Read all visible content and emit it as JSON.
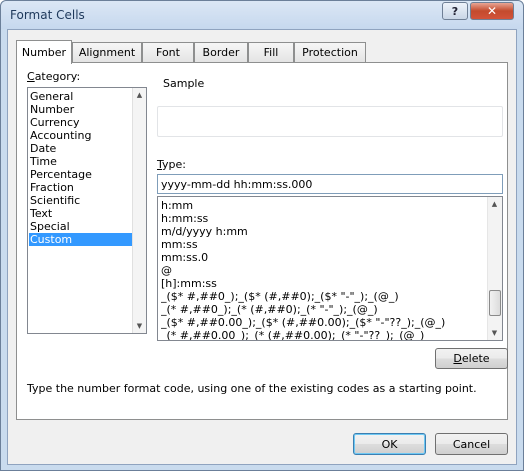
{
  "window": {
    "title": "Format Cells",
    "help_label": "?",
    "close_label": "✕"
  },
  "tabs": [
    {
      "label": "Number",
      "active": true
    },
    {
      "label": "Alignment",
      "active": false
    },
    {
      "label": "Font",
      "active": false
    },
    {
      "label": "Border",
      "active": false
    },
    {
      "label": "Fill",
      "active": false
    },
    {
      "label": "Protection",
      "active": false
    }
  ],
  "category": {
    "label_first": "C",
    "label_rest": "ategory:",
    "items": [
      "General",
      "Number",
      "Currency",
      "Accounting",
      "Date",
      "Time",
      "Percentage",
      "Fraction",
      "Scientific",
      "Text",
      "Special",
      "Custom"
    ],
    "selected": "Custom"
  },
  "sample": {
    "label": "Sample",
    "value": ""
  },
  "type": {
    "label_first": "T",
    "label_rest": "ype:",
    "value": "yyyy-mm-dd hh:mm:ss.000",
    "formats": [
      "h:mm",
      "h:mm:ss",
      "m/d/yyyy h:mm",
      "mm:ss",
      "mm:ss.0",
      "@",
      "[h]:mm:ss",
      "_($* #,##0_);_($* (#,##0);_($* \"-\"_);_(@_)",
      "_(* #,##0_);_(* (#,##0);_(* \"-\"_);_(@_)",
      "_($* #,##0.00_);_($* (#,##0.00);_($* \"-\"??_);_(@_)",
      "_(* #,##0.00_);_(* (#,##0.00);_(* \"-\"??_);_(@_)"
    ]
  },
  "buttons": {
    "delete_first": "D",
    "delete_rest": "elete",
    "ok": "OK",
    "cancel": "Cancel"
  },
  "hint": "Type the number format code, using one of the existing codes as a starting point.",
  "colors": {
    "selection": "#3399ff",
    "frame": "#c9dbee",
    "close_button": "#c44a2d"
  }
}
